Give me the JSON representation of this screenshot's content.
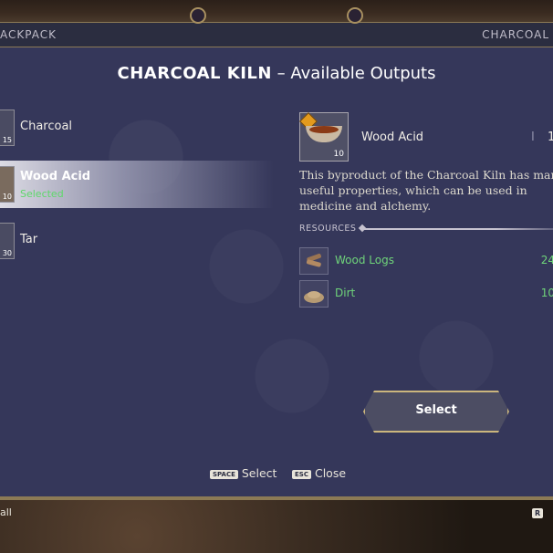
{
  "header": {
    "left_label": "ACKPACK",
    "right_label": "CHARCOAL"
  },
  "title": {
    "bold": "CHARCOAL KILN",
    "separator": " – ",
    "rest": "Available Outputs"
  },
  "outputs": [
    {
      "name": "Charcoal",
      "qty": "15",
      "status": "",
      "selected": false
    },
    {
      "name": "Wood Acid",
      "qty": "10",
      "status": "Selected",
      "selected": true
    },
    {
      "name": "Tar",
      "qty": "30",
      "status": "",
      "selected": false
    }
  ],
  "detail": {
    "name": "Wood Acid",
    "qty": "10",
    "extra_1": "I",
    "extra_2": "1",
    "description": "This byproduct of the Charcoal Kiln has many useful properties, which can be used in medicine and alchemy.",
    "resources_label": "RESOURCES",
    "resources": [
      {
        "name": "Wood Logs",
        "count": "24",
        "icon": "wood-logs-icon"
      },
      {
        "name": "Dirt",
        "count": "10",
        "icon": "dirt-icon"
      }
    ]
  },
  "select_button": {
    "label": "Select"
  },
  "hints": [
    {
      "key": "SPACE",
      "label": "Select"
    },
    {
      "key": "ESC",
      "label": "Close"
    }
  ],
  "footer": {
    "left": "all",
    "right_key": "R"
  },
  "colors": {
    "panel": "#35375a",
    "accent_gold": "#cbb67d",
    "status_green": "#5ed86a"
  }
}
